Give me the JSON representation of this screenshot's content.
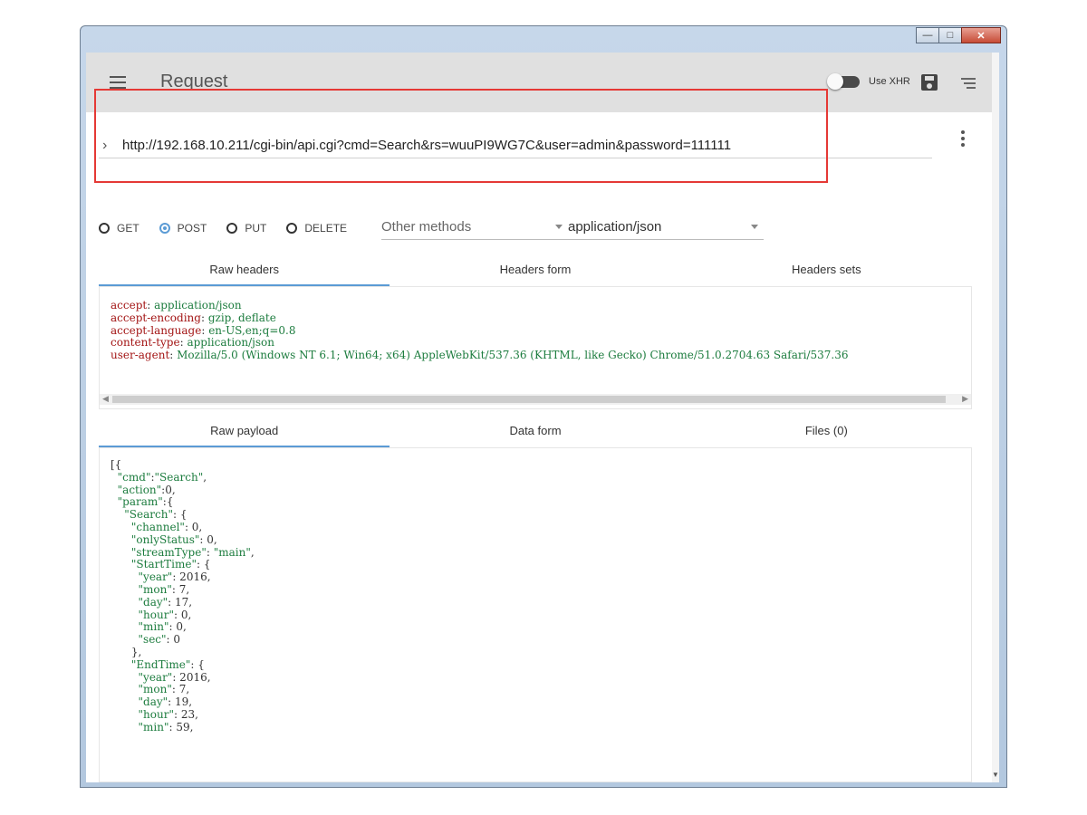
{
  "toolbar": {
    "title": "Request",
    "use_xhr_label": "Use XHR"
  },
  "request": {
    "url": "http://192.168.10.211/cgi-bin/api.cgi?cmd=Search&rs=wuuPI9WG7C&user=admin&password=111111"
  },
  "methods": {
    "options": [
      "GET",
      "POST",
      "PUT",
      "DELETE"
    ],
    "selected": "POST",
    "other_methods_placeholder": "Other methods",
    "content_type": "application/json"
  },
  "header_tabs": [
    "Raw headers",
    "Headers form",
    "Headers sets"
  ],
  "headers": [
    {
      "key": "accept",
      "value": "application/json"
    },
    {
      "key": "accept-encoding",
      "value": "gzip, deflate"
    },
    {
      "key": "accept-language",
      "value": "en-US,en;q=0.8"
    },
    {
      "key": "content-type",
      "value": "application/json"
    },
    {
      "key": "user-agent",
      "value": "Mozilla/5.0 (Windows NT 6.1; Win64; x64) AppleWebKit/537.36 (KHTML, like Gecko) Chrome/51.0.2704.63 Safari/537.36"
    }
  ],
  "payload_tabs": [
    "Raw payload",
    "Data form",
    "Files (0)"
  ],
  "payload_lines": [
    "[{",
    "  \"cmd\":\"Search\",",
    "  \"action\":0,",
    "  \"param\":{",
    "    \"Search\": {",
    "      \"channel\": 0,",
    "      \"onlyStatus\": 0,",
    "      \"streamType\": \"main\",",
    "      \"StartTime\": {",
    "        \"year\": 2016,",
    "        \"mon\": 7,",
    "        \"day\": 17,",
    "        \"hour\": 0,",
    "        \"min\": 0,",
    "        \"sec\": 0",
    "      },",
    "      \"EndTime\": {",
    "        \"year\": 2016,",
    "        \"mon\": 7,",
    "        \"day\": 19,",
    "        \"hour\": 23,",
    "        \"min\": 59,"
  ]
}
